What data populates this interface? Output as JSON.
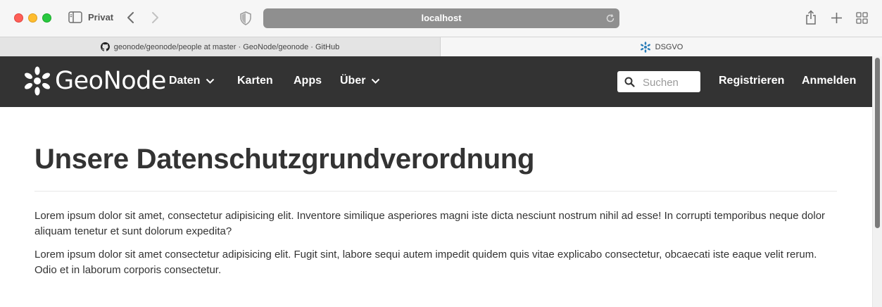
{
  "browser": {
    "privat_label": "Privat",
    "url": "localhost",
    "tabs": [
      {
        "title": "geonode/geonode/people at master · GeoNode/geonode · GitHub",
        "icon": "github-icon",
        "active": false
      },
      {
        "title": "DSGVO",
        "icon": "geonode-favicon-icon",
        "active": true
      }
    ]
  },
  "site": {
    "logo_text": "GeoNode",
    "nav": {
      "daten": "Daten",
      "karten": "Karten",
      "apps": "Apps",
      "ueber": "Über"
    },
    "search": {
      "placeholder": "Suchen",
      "value": ""
    },
    "registrieren": "Registrieren",
    "anmelden": "Anmelden"
  },
  "main": {
    "title": "Unsere Datenschutzgrundverordnung",
    "paragraphs": [
      "Lorem ipsum dolor sit amet, consectetur adipisicing elit. Inventore similique asperiores magni iste dicta nesciunt nostrum nihil ad esse! In corrupti temporibus neque dolor aliquam tenetur et sunt dolorum expedita?",
      "Lorem ipsum dolor sit amet consectetur adipisicing elit. Fugit sint, labore sequi autem impedit quidem quis vitae explicabo consectetur, obcaecati iste eaque velit rerum. Odio et in laborum corporis consectetur."
    ]
  },
  "colors": {
    "navbar_bg": "#333333",
    "text": "#333333",
    "url_bar": "#8f8f8f",
    "favicon_blue": "#2a7db8"
  }
}
